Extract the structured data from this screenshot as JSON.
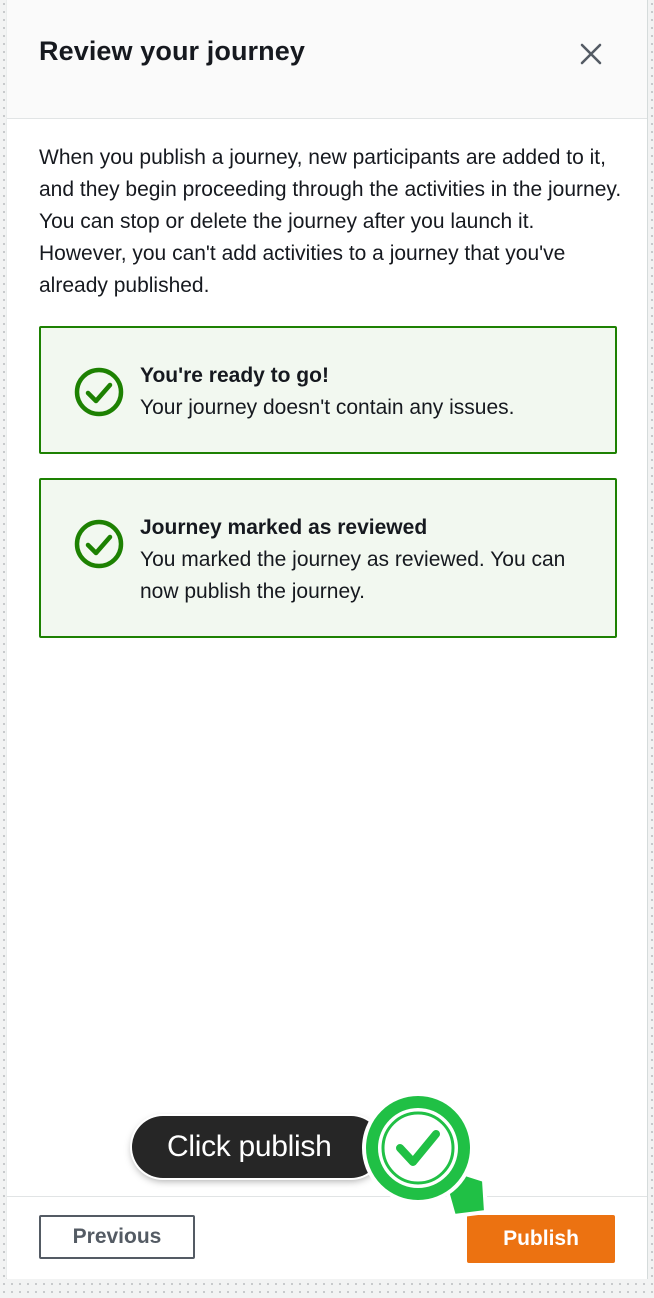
{
  "modal": {
    "title": "Review your journey",
    "close_icon": "close-icon",
    "description": "When you publish a journey, new participants are added to it, and they begin proceeding through the activities in the journey. You can stop or delete the journey after you launch it. However, you can't add activities to a journey that you've already published."
  },
  "alerts": [
    {
      "icon": "check-circle-icon",
      "title": "You're ready to go!",
      "message": "Your journey doesn't contain any issues."
    },
    {
      "icon": "check-circle-icon",
      "title": "Journey marked as reviewed",
      "message": "You marked the journey as reviewed. You can now publish the journey."
    }
  ],
  "footer": {
    "previous_label": "Previous",
    "publish_label": "Publish"
  },
  "guide": {
    "tooltip": "Click publish",
    "pointer_icon": "checkmark-pointer-icon"
  },
  "colors": {
    "success": "#1d8102",
    "success_bg": "#f2f8f0",
    "primary": "#ec7211",
    "guide_green": "#20c045"
  }
}
